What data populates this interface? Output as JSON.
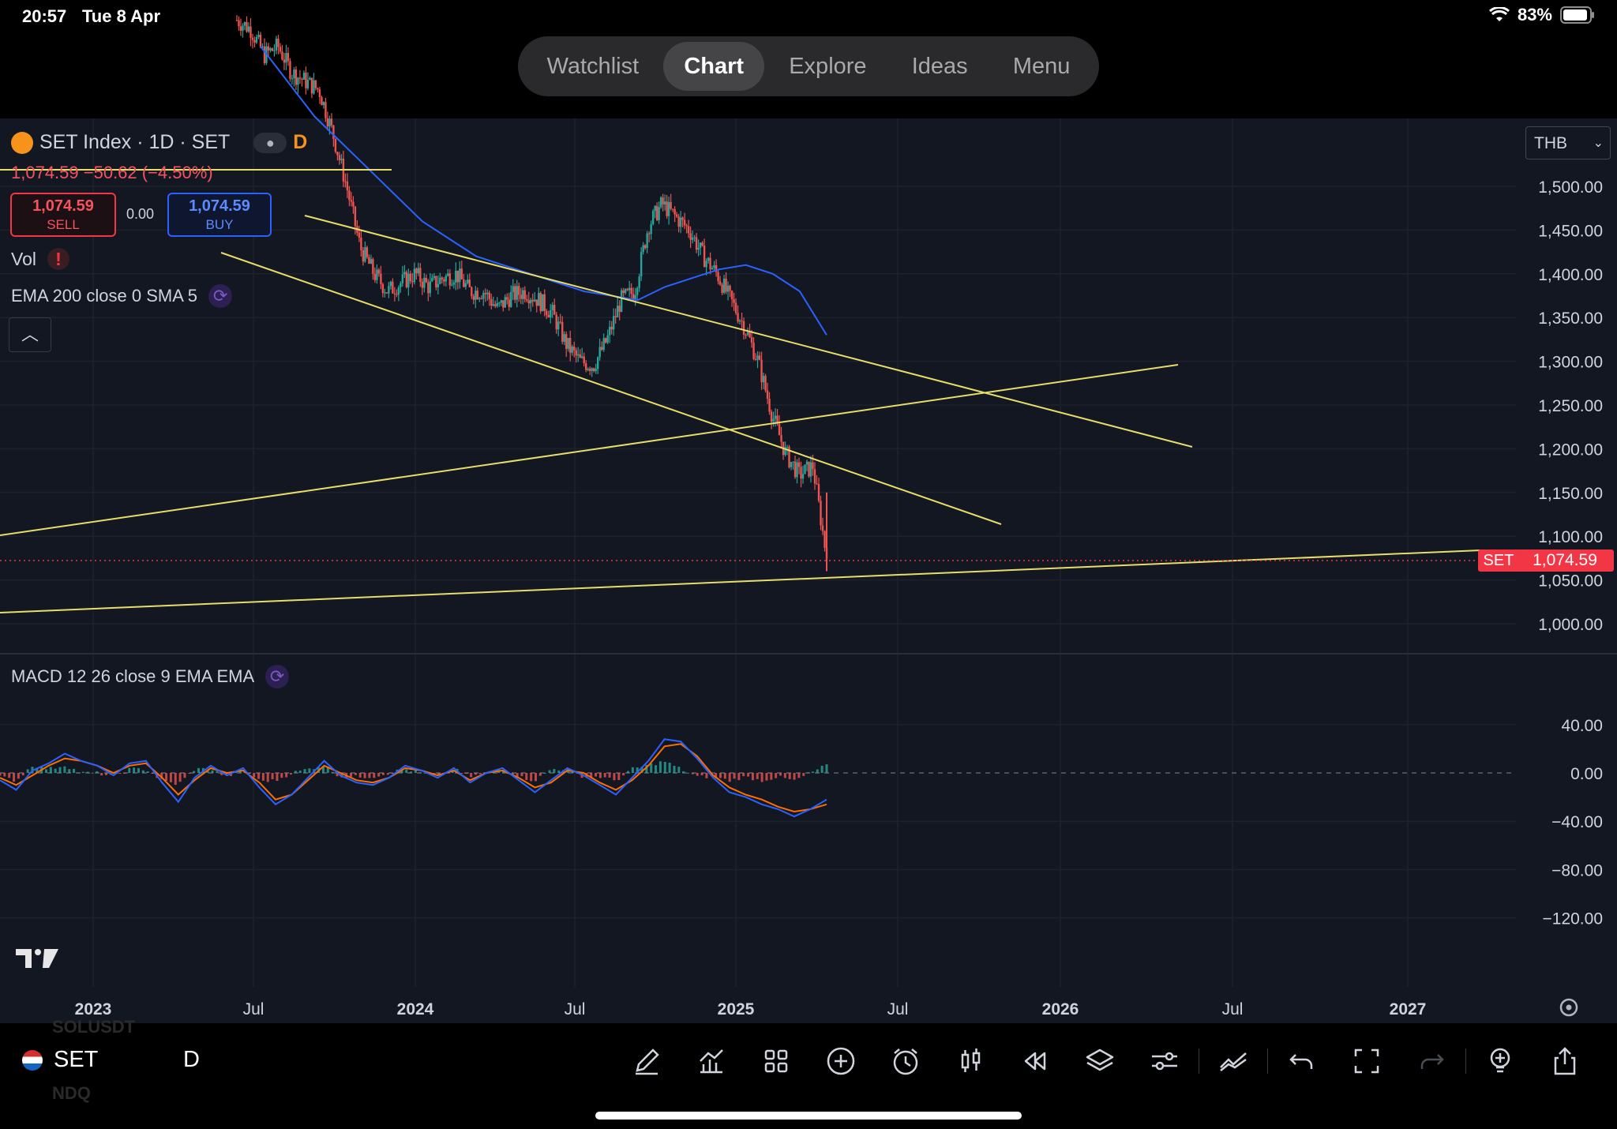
{
  "status_bar": {
    "time": "20:57",
    "date": "Tue 8 Apr",
    "battery": "83%"
  },
  "nav_tabs": [
    {
      "label": "Watchlist",
      "active": false
    },
    {
      "label": "Chart",
      "active": true
    },
    {
      "label": "Explore",
      "active": false
    },
    {
      "label": "Ideas",
      "active": false
    },
    {
      "label": "Menu",
      "active": false
    }
  ],
  "legend": {
    "symbol_title": "SET Index · 1D · SET",
    "interval_badge": "D",
    "quote_line": "1,074.59 −50.62 (−4.50%)",
    "sell_price": "1,074.59",
    "sell_label": "SELL",
    "spread": "0.00",
    "buy_price": "1,074.59",
    "buy_label": "BUY",
    "vol_label": "Vol",
    "ema_label": "EMA 200 close 0 SMA 5",
    "macd_label": "MACD 12 26 close 9 EMA EMA"
  },
  "currency": "THB",
  "last_price": {
    "symbol": "SET",
    "value": "1,074.59"
  },
  "colors": {
    "background": "#131722",
    "up": "#26a69a",
    "down": "#ef5350",
    "trendline": "#e8dc6a",
    "ema": "#2962ff",
    "macd": "#2962ff",
    "signal": "#ff6d00",
    "price_label": "#f23645"
  },
  "chart_data": {
    "type": "line",
    "title": "SET Index · 1D · SET",
    "price_axis": {
      "ticks": [
        "1,500.00",
        "1,450.00",
        "1,400.00",
        "1,350.00",
        "1,300.00",
        "1,250.00",
        "1,200.00",
        "1,150.00",
        "1,100.00",
        "1,050.00",
        "1,000.00"
      ],
      "ylim": [
        1000,
        1500
      ]
    },
    "macd_axis": {
      "ticks": [
        "40.00",
        "0.00",
        "−40.00",
        "−80.00",
        "−120.00"
      ],
      "ylim": [
        -120,
        40
      ]
    },
    "time_axis": [
      {
        "label": "2023",
        "bold": true
      },
      {
        "label": "Jul",
        "bold": false
      },
      {
        "label": "2024",
        "bold": true
      },
      {
        "label": "Jul",
        "bold": false
      },
      {
        "label": "2025",
        "bold": true
      },
      {
        "label": "Jul",
        "bold": false
      },
      {
        "label": "2026",
        "bold": true
      },
      {
        "label": "Jul",
        "bold": false
      },
      {
        "label": "2027",
        "bold": true
      }
    ],
    "series": [
      {
        "values": [
          1690,
          1680,
          1650,
          1660,
          1630,
          1620,
          1610,
          1560,
          1500,
          1430,
          1400,
          1380,
          1390,
          1400,
          1385,
          1395,
          1400,
          1380,
          1380,
          1360,
          1375,
          1380,
          1370,
          1355,
          1320,
          1300,
          1295,
          1325,
          1370,
          1380,
          1455,
          1480,
          1465,
          1450,
          1420,
          1400,
          1370,
          1340,
          1300,
          1240,
          1195,
          1170,
          1180,
          1074.59
        ]
      },
      {
        "name": "EMA 200",
        "values": [
          1660,
          1620,
          1580,
          1550,
          1520,
          1490,
          1460,
          1440,
          1420,
          1410,
          1400,
          1390,
          1380,
          1375,
          1370,
          1385,
          1395,
          1405,
          1410,
          1400,
          1380,
          1330
        ]
      },
      {
        "name": "MACD",
        "values": [
          -6,
          -14,
          2,
          8,
          16,
          10,
          6,
          -2,
          8,
          10,
          -8,
          -24,
          -4,
          6,
          -2,
          4,
          -12,
          -26,
          -18,
          -4,
          10,
          -2,
          -8,
          -10,
          -4,
          6,
          2,
          -4,
          4,
          -8,
          0,
          4,
          -6,
          -16,
          -6,
          4,
          -2,
          -10,
          -18,
          -4,
          10,
          28,
          26,
          12,
          -4,
          -16,
          -20,
          -26,
          -30,
          -36,
          -30,
          -22
        ]
      },
      {
        "name": "Signal",
        "values": [
          -4,
          -10,
          -2,
          6,
          12,
          10,
          6,
          0,
          6,
          8,
          -4,
          -18,
          -6,
          4,
          0,
          2,
          -8,
          -22,
          -18,
          -6,
          6,
          0,
          -6,
          -8,
          -4,
          4,
          2,
          -2,
          2,
          -6,
          0,
          2,
          -4,
          -12,
          -8,
          2,
          0,
          -8,
          -14,
          -6,
          6,
          22,
          24,
          14,
          -2,
          -12,
          -18,
          -22,
          -28,
          -32,
          -30,
          -26
        ]
      }
    ]
  }
}
